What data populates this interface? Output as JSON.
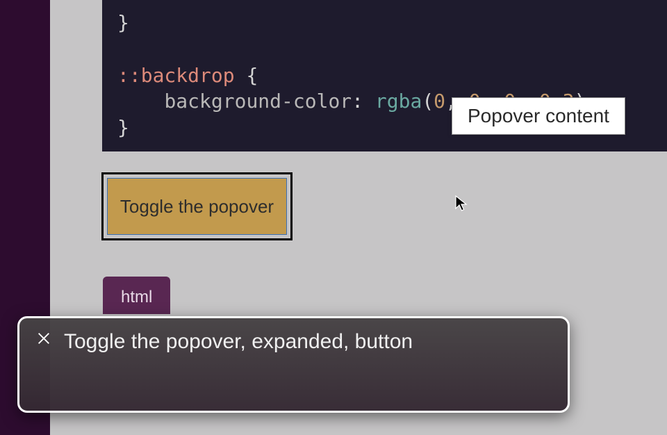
{
  "code": {
    "brace_prev": "}",
    "selector": "::backdrop",
    "open_brace": "{",
    "prop": "background-color",
    "colon": ":",
    "func": "rgba",
    "open_paren": "(",
    "n0": "0",
    "n1": "0",
    "n2": "0",
    "n3": "0.3",
    "close_paren": ")",
    "semi": ";",
    "close_brace": "}"
  },
  "popover": {
    "content": "Popover content"
  },
  "button": {
    "label": "Toggle the popover"
  },
  "tab": {
    "html_label": "html"
  },
  "a11y": {
    "close_label": "Close",
    "announcement": "Toggle the popover, expanded, button"
  }
}
